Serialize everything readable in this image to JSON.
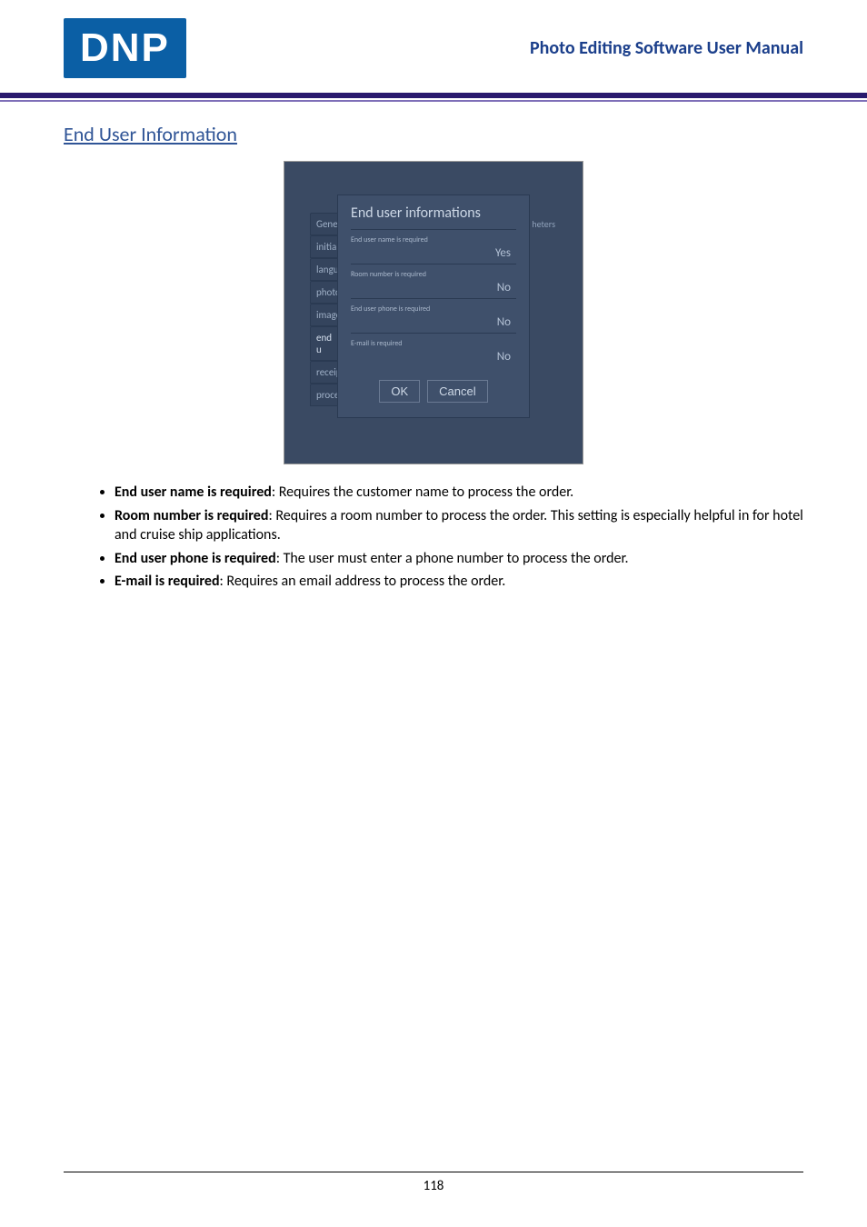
{
  "header": {
    "logo_text": "DNP",
    "title": "Photo Editing Software User Manual"
  },
  "section_title": "End User Information",
  "screenshot": {
    "tabs": [
      "Gener",
      "initial",
      "langu",
      "photo",
      "image",
      "end u",
      "receip",
      "proce"
    ],
    "panel_title": "End user informations",
    "right_fragment": "heters",
    "rows": [
      {
        "label": "End user name is required",
        "value": "Yes"
      },
      {
        "label": "Room number is required",
        "value": "No"
      },
      {
        "label": "End user phone is required",
        "value": "No"
      },
      {
        "label": "E-mail is required",
        "value": "No"
      }
    ],
    "ok_label": "OK",
    "cancel_label": "Cancel"
  },
  "bullets": [
    {
      "bold": "End user name is required",
      "rest": ": Requires the customer name to process the order."
    },
    {
      "bold": "Room number is required",
      "rest": ": Requires a room number to process the order. This setting is especially helpful in for hotel and cruise ship applications."
    },
    {
      "bold": "End user phone is required",
      "rest": ": The user must enter a phone number to process the order."
    },
    {
      "bold": "E-mail is required",
      "rest": ": Requires an email address to process the order."
    }
  ],
  "page_number": "118"
}
